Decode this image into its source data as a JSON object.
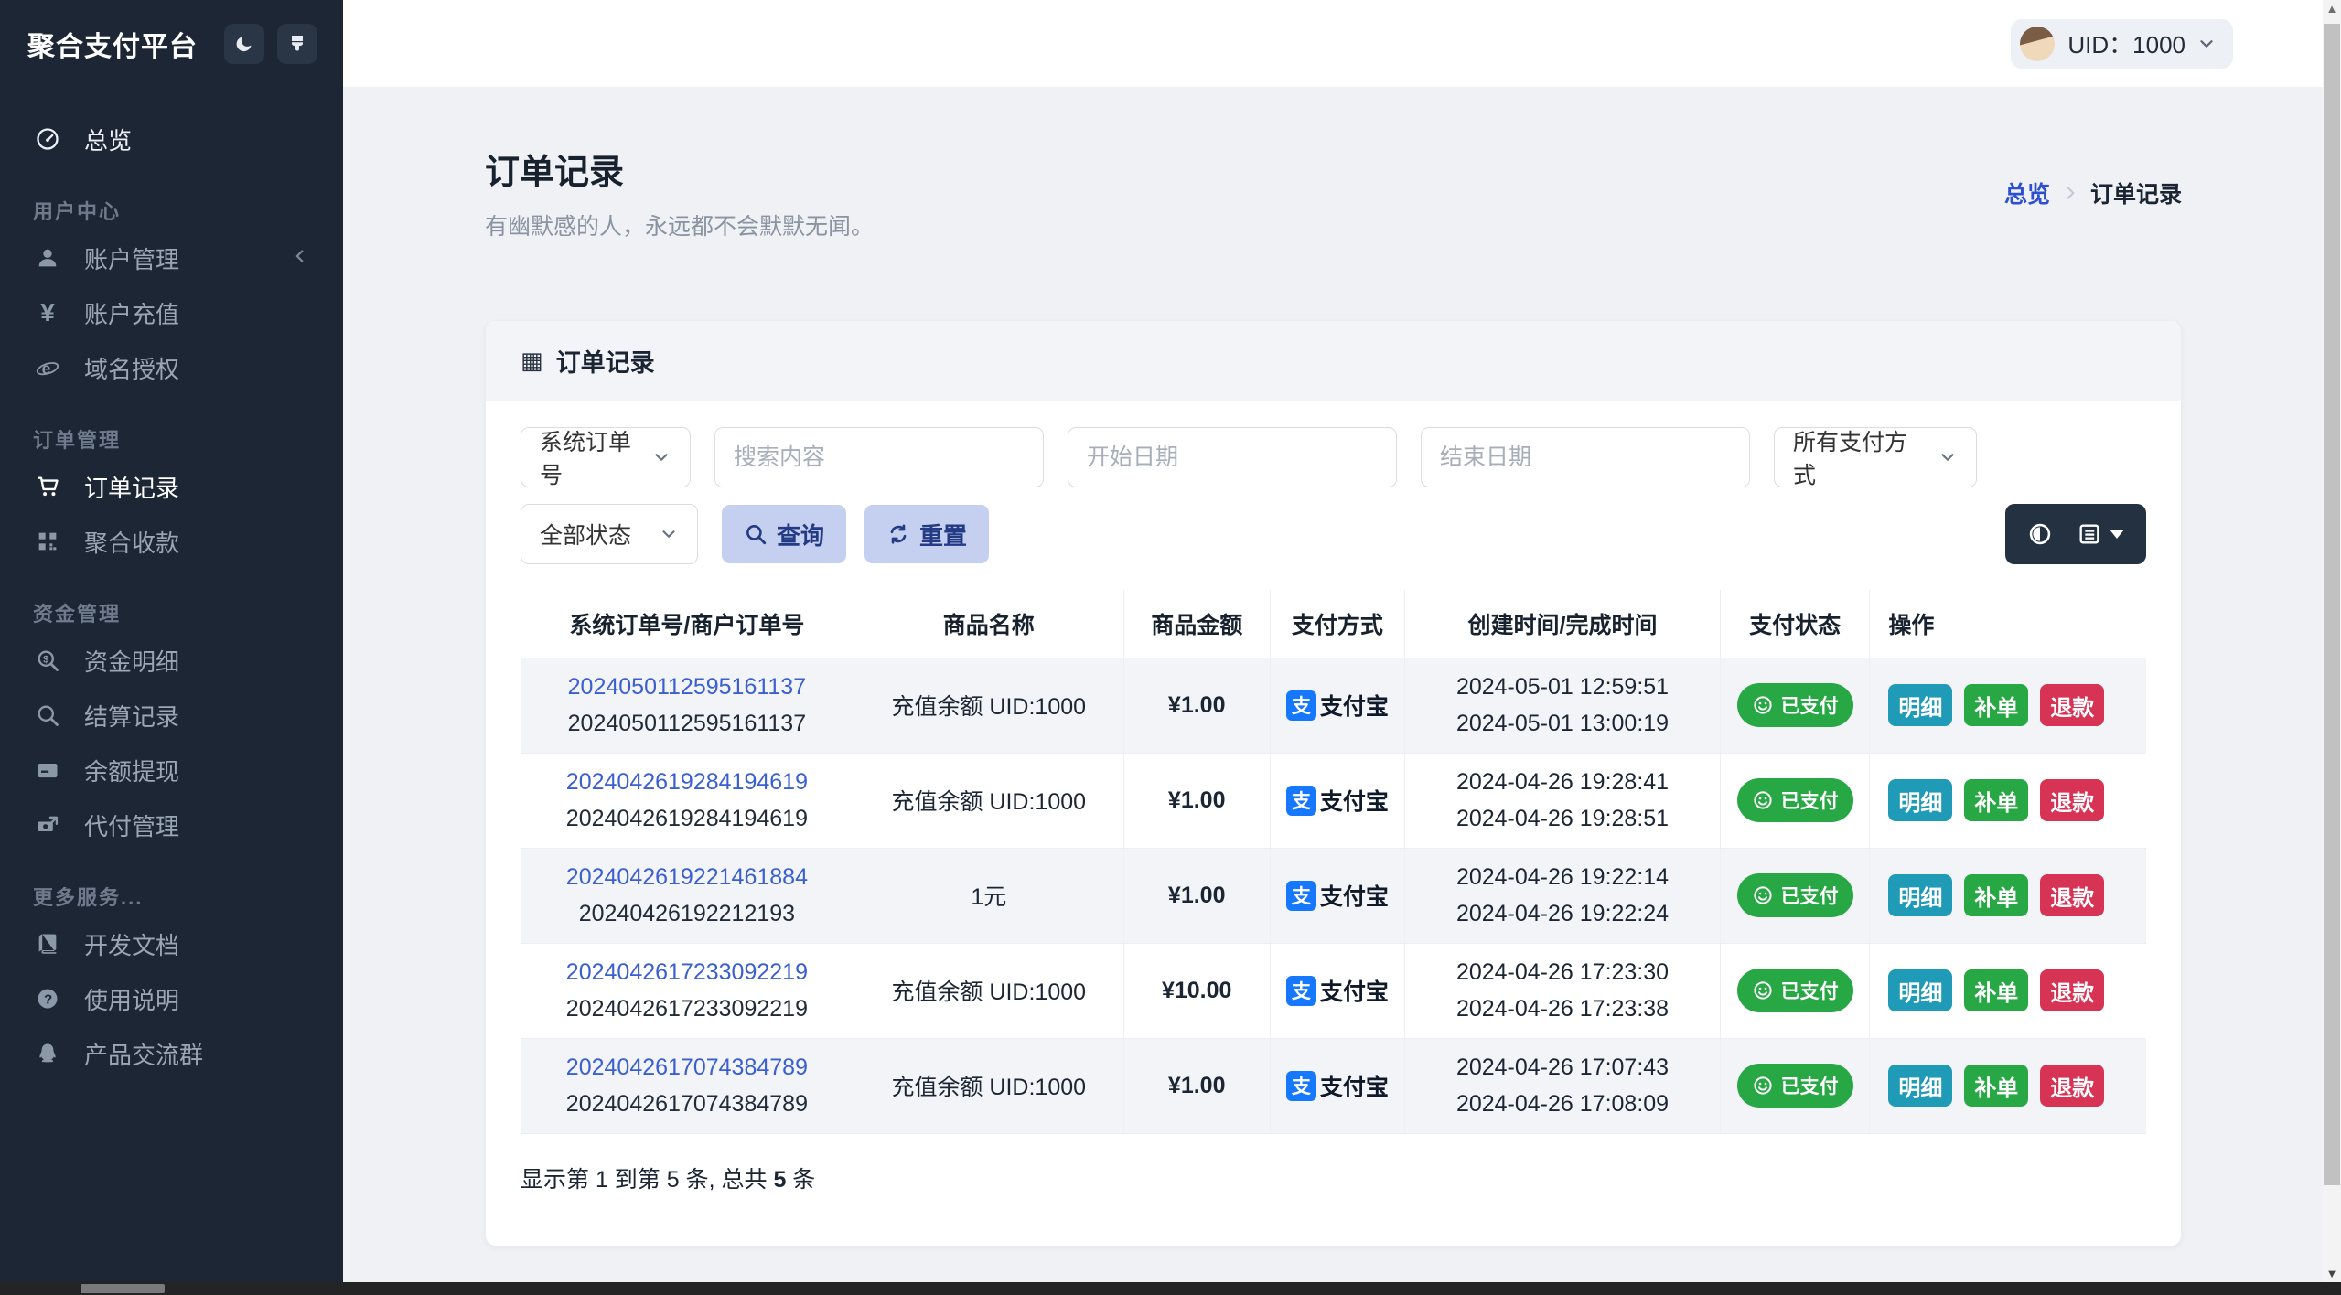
{
  "app": {
    "title": "聚合支付平台"
  },
  "topbar": {
    "uid": "UID：1000"
  },
  "sidebar": {
    "overview": "总览",
    "sections": [
      {
        "label": "用户中心",
        "items": [
          {
            "label": "账户管理"
          },
          {
            "label": "账户充值"
          },
          {
            "label": "域名授权"
          }
        ]
      },
      {
        "label": "订单管理",
        "items": [
          {
            "label": "订单记录"
          },
          {
            "label": "聚合收款"
          }
        ]
      },
      {
        "label": "资金管理",
        "items": [
          {
            "label": "资金明细"
          },
          {
            "label": "结算记录"
          },
          {
            "label": "余额提现"
          },
          {
            "label": "代付管理"
          }
        ]
      },
      {
        "label": "更多服务...",
        "items": [
          {
            "label": "开发文档"
          },
          {
            "label": "使用说明"
          },
          {
            "label": "产品交流群"
          }
        ]
      }
    ]
  },
  "page": {
    "title": "订单记录",
    "subtitle": "有幽默感的人，永远都不会默默无闻。",
    "breadcrumb_home": "总览",
    "breadcrumb_current": "订单记录"
  },
  "card": {
    "title": "订单记录"
  },
  "filters": {
    "order_no_type": "系统订单号",
    "search_placeholder": "搜索内容",
    "start_date_placeholder": "开始日期",
    "end_date_placeholder": "结束日期",
    "pay_method": "所有支付方式",
    "status": "全部状态",
    "query": "查询",
    "reset": "重置"
  },
  "table": {
    "headers": [
      "系统订单号/商户订单号",
      "商品名称",
      "商品金额",
      "支付方式",
      "创建时间/完成时间",
      "支付状态",
      "操作"
    ],
    "actions": {
      "detail": "明细",
      "reorder": "补单",
      "refund": "退款"
    },
    "status_paid": "已支付",
    "alipay": "支付宝",
    "alipay_glyph": "支",
    "rows": [
      {
        "system_no": "2024050112595161137",
        "merchant_no": "2024050112595161137",
        "product": "充值余额 UID:1000",
        "amount": "¥1.00",
        "created": "2024-05-01 12:59:51",
        "finished": "2024-05-01 13:00:19"
      },
      {
        "system_no": "2024042619284194619",
        "merchant_no": "2024042619284194619",
        "product": "充值余额 UID:1000",
        "amount": "¥1.00",
        "created": "2024-04-26 19:28:41",
        "finished": "2024-04-26 19:28:51"
      },
      {
        "system_no": "2024042619221461884",
        "merchant_no": "20240426192212193",
        "product": "1元",
        "amount": "¥1.00",
        "created": "2024-04-26 19:22:14",
        "finished": "2024-04-26 19:22:24"
      },
      {
        "system_no": "2024042617233092219",
        "merchant_no": "2024042617233092219",
        "product": "充值余额 UID:1000",
        "amount": "¥10.00",
        "created": "2024-04-26 17:23:30",
        "finished": "2024-04-26 17:23:38"
      },
      {
        "system_no": "2024042617074384789",
        "merchant_no": "2024042617074384789",
        "product": "充值余额 UID:1000",
        "amount": "¥1.00",
        "created": "2024-04-26 17:07:43",
        "finished": "2024-04-26 17:08:09"
      }
    ],
    "pagination": {
      "prefix": "显示第 1 到第 5 条, 总共",
      "total": "5",
      "suffix": "条"
    }
  },
  "colors": {
    "sidebar_bg": "#1d2635",
    "accent_blue": "#3a5fd1",
    "success_green": "#28a745",
    "info_teal": "#1f9ab7",
    "danger_red": "#d63355",
    "alipay_blue": "#1677ff",
    "soft_button_bg": "#c5cfef",
    "soft_button_text": "#233a85"
  }
}
